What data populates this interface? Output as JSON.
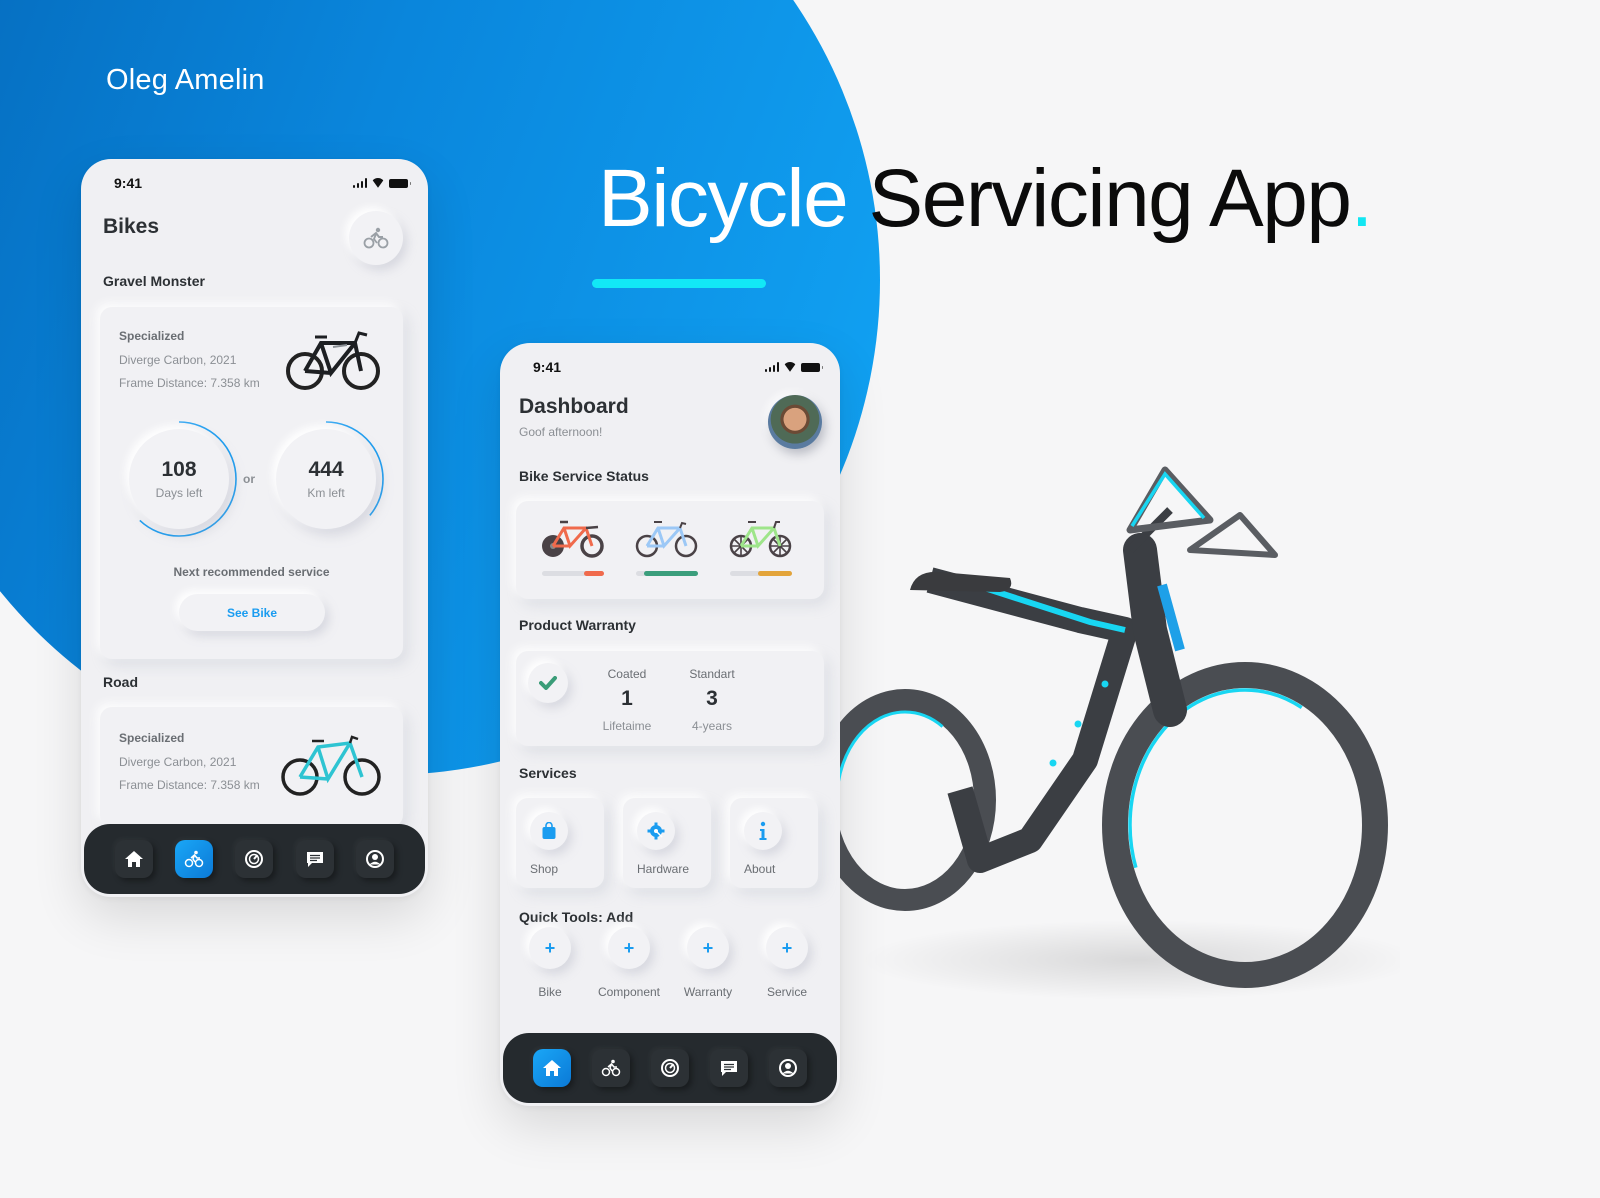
{
  "author": "Oleg Amelin",
  "headline": {
    "word1": "Bicycle",
    "word2": "Servicing App",
    "dot": "."
  },
  "colors": {
    "accent": "#1a9cf0",
    "cyan": "#12e6f2",
    "dark_bar": "#252a2e",
    "blue_dark": "#0467b8",
    "blue_light": "#12a6f6"
  },
  "bikes_screen": {
    "status_time": "9:41",
    "title": "Bikes",
    "header_icon": "cyclist-icon",
    "sections": [
      {
        "name": "Gravel Monster",
        "brand": "Specialized",
        "model": "Diverge Carbon, 2021",
        "distance": "Frame Distance: 7.358 km",
        "rings": [
          {
            "value": "108",
            "label": "Days left",
            "progress": 0.62
          },
          {
            "value": "444",
            "label": "Km left",
            "progress": 0.36
          }
        ],
        "or_label": "or",
        "next_label": "Next recommended service",
        "button": "See Bike"
      },
      {
        "name": "Road",
        "brand": "Specialized",
        "model": "Diverge Carbon, 2021",
        "distance": "Frame Distance: 7.358 km"
      }
    ],
    "tabbar": {
      "active": 1,
      "items": [
        "home-icon",
        "bike-icon",
        "speedometer-icon",
        "chat-icon",
        "profile-icon"
      ]
    }
  },
  "dashboard_screen": {
    "status_time": "9:41",
    "title": "Dashboard",
    "greeting": "Goof afternoon!",
    "service_status": {
      "title": "Bike Service Status",
      "bikes": [
        {
          "name": "red-bike",
          "color": "#f06a4c",
          "progress": 0.33
        },
        {
          "name": "blue-bike",
          "color": "#3b9e7c",
          "progress": 0.87
        },
        {
          "name": "green-bike",
          "color": "#e3a43a",
          "progress": 0.55
        }
      ]
    },
    "warranty": {
      "title": "Product Warranty",
      "items": [
        {
          "header": "Coated",
          "value": "1",
          "footer": "Lifetaime"
        },
        {
          "header": "Standart",
          "value": "3",
          "footer": "4-years"
        }
      ]
    },
    "services": {
      "title": "Services",
      "items": [
        {
          "label": "Shop",
          "icon": "shopping-bag-icon"
        },
        {
          "label": "Hardware",
          "icon": "gear-wrench-icon"
        },
        {
          "label": "About",
          "icon": "info-icon"
        }
      ]
    },
    "quick_tools": {
      "title": "Quick Tools: Add",
      "plus": "+",
      "items": [
        "Bike",
        "Component",
        "Warranty",
        "Service"
      ]
    },
    "tabbar": {
      "active": 0,
      "items": [
        "home-icon",
        "bike-icon",
        "speedometer-icon",
        "chat-icon",
        "profile-icon"
      ]
    }
  }
}
